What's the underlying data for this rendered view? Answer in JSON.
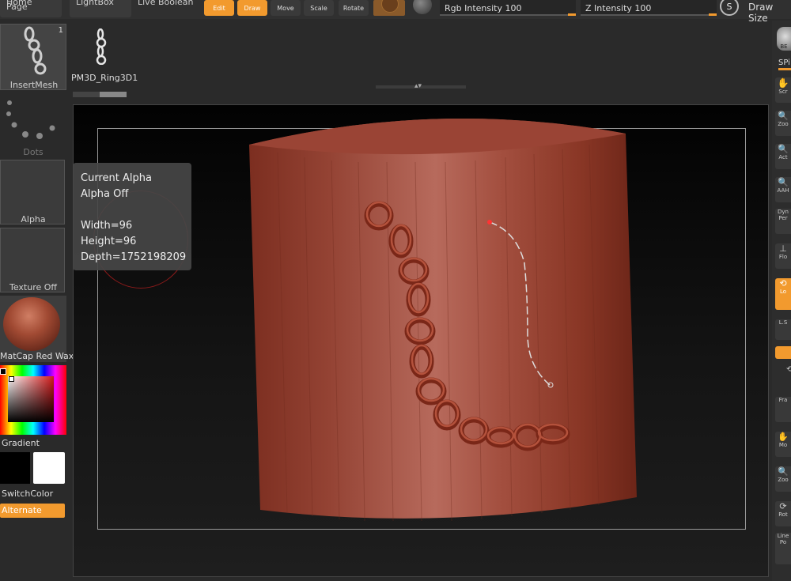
{
  "top_tabs": [
    "Home Page",
    "LightBox",
    "Live Boolean"
  ],
  "tools": [
    {
      "label": "Edit",
      "active": true
    },
    {
      "label": "Draw",
      "active": true
    },
    {
      "label": "Move",
      "active": false
    },
    {
      "label": "Scale",
      "active": false
    },
    {
      "label": "Rotate",
      "active": false
    }
  ],
  "sliders": {
    "rgb_label": "Rgb Intensity 100",
    "z_label": "Z Intensity 100",
    "draw_size_label": "Draw Size",
    "s_icon_label": "S"
  },
  "brush": {
    "insert_mesh_label": "InsertMesh",
    "insert_mesh_count": "1",
    "mesh_name": "PM3D_Ring3D1",
    "stroke_label": "Dots",
    "alpha_label": "Alpha",
    "texture_label": "Texture Off",
    "material_label": "MatCap Red Wax"
  },
  "colors": {
    "gradient_label": "Gradient",
    "switch_label": "SwitchColor",
    "alternate_label": "Alternate",
    "accent": "#f29a2e"
  },
  "tooltip": {
    "title": "Current Alpha",
    "line2": "Alpha Off",
    "width": "Width=96",
    "height": "Height=96",
    "depth": "Depth=1752198209"
  },
  "right_panel": {
    "top_label": "BE",
    "spi_label": "SPi",
    "buttons": [
      "Scr",
      "Zoo",
      "Act",
      "AAH",
      "Dyn Per",
      "Flo",
      "Lo",
      "L.S",
      "",
      "",
      "Fra",
      "Mo",
      "Zoo",
      "Rot",
      "Line Po"
    ]
  }
}
